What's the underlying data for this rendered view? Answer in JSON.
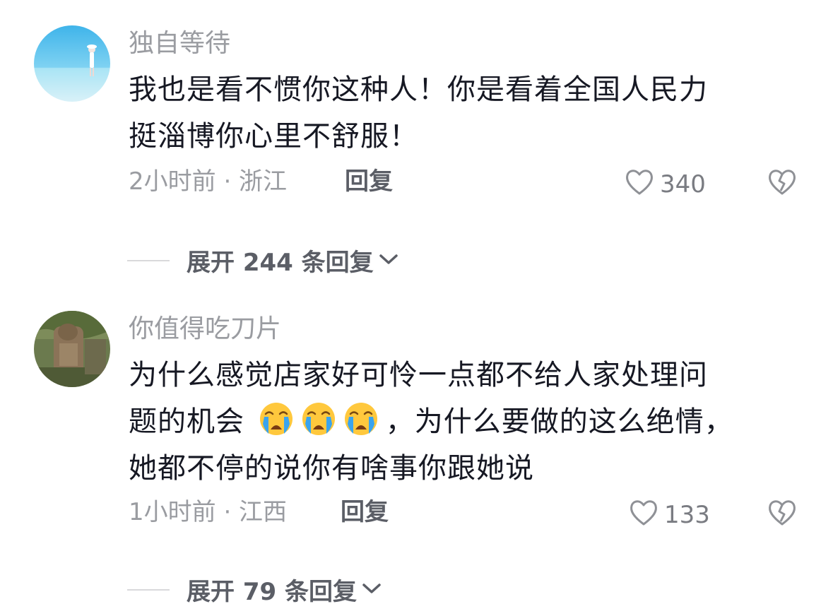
{
  "comments": [
    {
      "username": "独自等待",
      "lines": [
        "我也是看不惯你这种人！你是看着全国人民力",
        "挺淄博你心里不舒服！"
      ],
      "time_location": "2小时前 · 浙江",
      "reply_label": "回复",
      "like_count": "340",
      "expand_label": "展开 244 条回复"
    },
    {
      "username": "你值得吃刀片",
      "lines": [
        "为什么感觉店家好可怜一点都不给人家处理问",
        "题的机会",
        "，为什么要做的这么绝情，",
        "她都不停的说你有啥事你跟她说"
      ],
      "emoji": [
        "loudly-crying-face",
        "loudly-crying-face",
        "loudly-crying-face"
      ],
      "time_location": "1小时前 · 江西",
      "reply_label": "回复",
      "like_count": "133",
      "expand_label": "展开 79 条回复"
    }
  ],
  "icons": {
    "like": "heart-outline-icon",
    "dislike": "broken-heart-icon",
    "expand": "chevron-down-icon"
  }
}
